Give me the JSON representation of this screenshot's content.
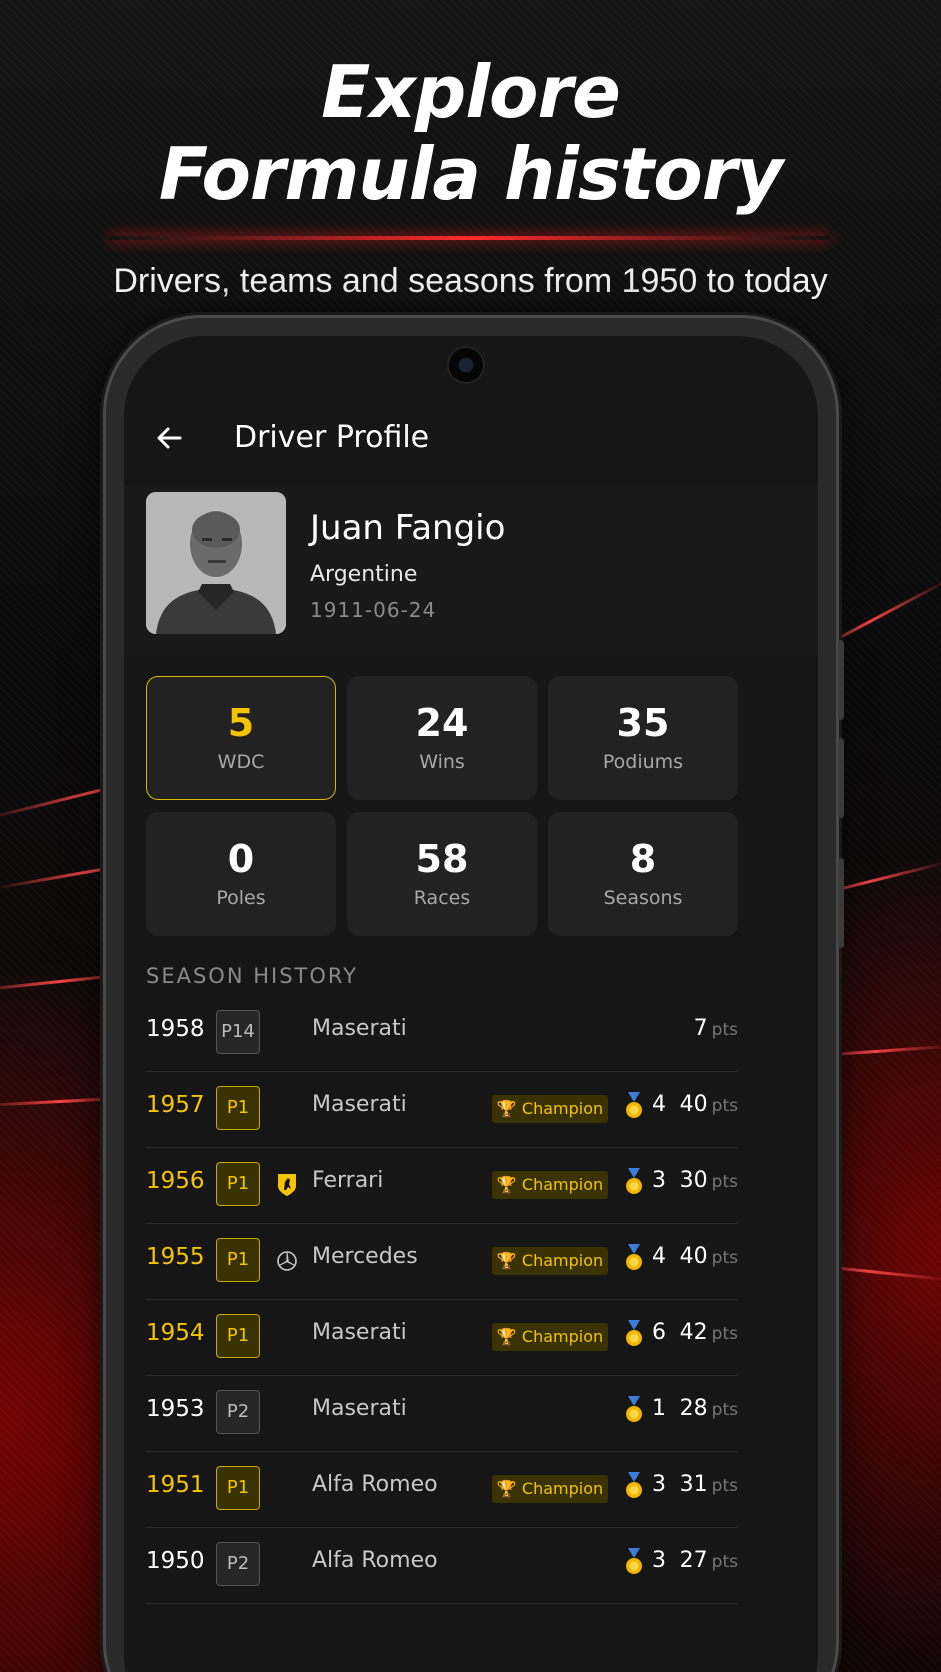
{
  "hero": {
    "title_line1": "Explore",
    "title_line2": "Formula history",
    "subtitle": "Drivers, teams and seasons from 1950 to today"
  },
  "appbar": {
    "title": "Driver Profile"
  },
  "driver": {
    "name": "Juan Fangio",
    "nationality": "Argentine",
    "dob": "1911-06-24"
  },
  "stats": [
    {
      "value": "5",
      "label": "WDC",
      "highlight": true
    },
    {
      "value": "24",
      "label": "Wins"
    },
    {
      "value": "35",
      "label": "Podiums"
    },
    {
      "value": "0",
      "label": "Poles"
    },
    {
      "value": "58",
      "label": "Races"
    },
    {
      "value": "8",
      "label": "Seasons"
    }
  ],
  "season_history": {
    "title": "SEASON HISTORY",
    "pts_unit": "pts",
    "champion_label": "Champion",
    "rows": [
      {
        "year": "1958",
        "pos": "P14",
        "team": "Maserati",
        "team_icon": "",
        "champion": false,
        "podiums": "",
        "pts": "7"
      },
      {
        "year": "1957",
        "pos": "P1",
        "team": "Maserati",
        "team_icon": "",
        "champion": true,
        "podiums": "4",
        "pts": "40"
      },
      {
        "year": "1956",
        "pos": "P1",
        "team": "Ferrari",
        "team_icon": "ferrari-horse-icon",
        "champion": true,
        "podiums": "3",
        "pts": "30"
      },
      {
        "year": "1955",
        "pos": "P1",
        "team": "Mercedes",
        "team_icon": "mercedes-star-icon",
        "champion": true,
        "podiums": "4",
        "pts": "40"
      },
      {
        "year": "1954",
        "pos": "P1",
        "team": "Maserati",
        "team_icon": "",
        "champion": true,
        "podiums": "6",
        "pts": "42"
      },
      {
        "year": "1953",
        "pos": "P2",
        "team": "Maserati",
        "team_icon": "",
        "champion": false,
        "podiums": "1",
        "pts": "28"
      },
      {
        "year": "1951",
        "pos": "P1",
        "team": "Alfa Romeo",
        "team_icon": "",
        "champion": true,
        "podiums": "3",
        "pts": "31"
      },
      {
        "year": "1950",
        "pos": "P2",
        "team": "Alfa Romeo",
        "team_icon": "",
        "champion": false,
        "podiums": "3",
        "pts": "27"
      }
    ]
  },
  "colors": {
    "accent_gold": "#f4c400",
    "brand_red": "#ff2a2a",
    "background": "#0a0a0a"
  }
}
